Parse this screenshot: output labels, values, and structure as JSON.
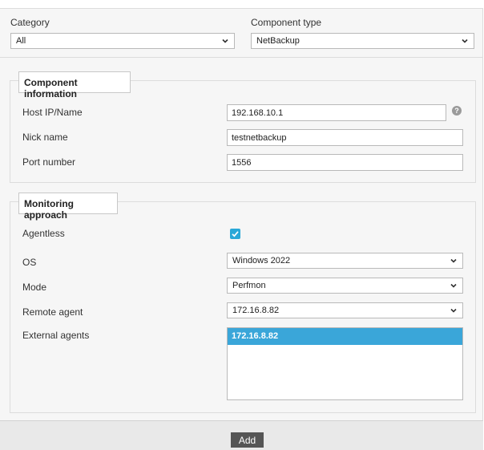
{
  "filters": {
    "category_label": "Category",
    "category_value": "All",
    "component_type_label": "Component type",
    "component_type_value": "NetBackup"
  },
  "component_info": {
    "legend": "Component information",
    "host_label": "Host IP/Name",
    "host_value": "192.168.10.1",
    "help_icon": "?",
    "nick_label": "Nick name",
    "nick_value": "testnetbackup",
    "port_label": "Port number",
    "port_value": "1556"
  },
  "monitoring": {
    "legend": "Monitoring approach",
    "agentless_label": "Agentless",
    "agentless_checked": true,
    "os_label": "OS",
    "os_value": "Windows 2022",
    "mode_label": "Mode",
    "mode_value": "Perfmon",
    "remote_agent_label": "Remote agent",
    "remote_agent_value": "172.16.8.82",
    "external_agents_label": "External agents",
    "external_agents": [
      "172.16.8.82"
    ]
  },
  "footer": {
    "add_label": "Add"
  },
  "colors": {
    "accent": "#3aa6d9",
    "button": "#555555"
  }
}
